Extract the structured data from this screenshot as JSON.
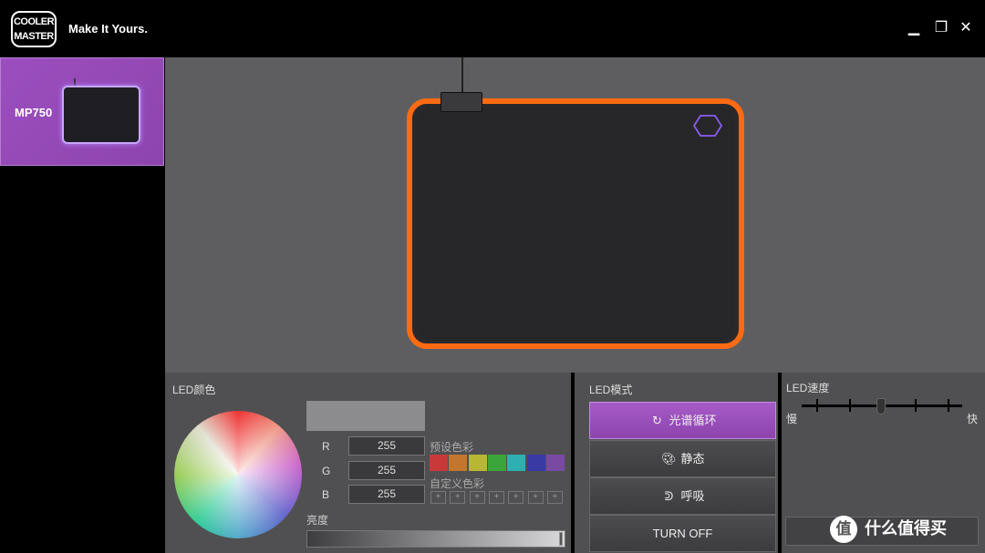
{
  "header": {
    "logo_text_1": "COOLER",
    "logo_text_2": "MASTER",
    "tagline": "Make It Yours.",
    "minimize": "▁",
    "maximize": "❐",
    "close": "✕"
  },
  "sidebar": {
    "devices": [
      {
        "name": "MP750"
      }
    ]
  },
  "color_panel": {
    "title": "LED颜色",
    "r_label": "R",
    "r_value": "255",
    "g_label": "G",
    "g_value": "255",
    "b_label": "B",
    "b_value": "255",
    "preset_label": "预设色彩",
    "presets": [
      "#c83a3a",
      "#c4762f",
      "#b7b734",
      "#3aa53a",
      "#2eb0b0",
      "#3a3aa5",
      "#7a4aa2"
    ],
    "custom_label": "自定义色彩",
    "custom_add": "+",
    "brightness_label": "亮度",
    "brightness_level": 1.0
  },
  "mode_panel": {
    "title": "LED模式",
    "modes": [
      {
        "label": "光谱循环",
        "icon": "refresh-icon",
        "active": true
      },
      {
        "label": "静态",
        "icon": "palette-icon",
        "active": false
      },
      {
        "label": "呼吸",
        "icon": "lungs-icon",
        "active": false
      },
      {
        "label": "TURN OFF",
        "icon": "",
        "active": false
      }
    ]
  },
  "speed_panel": {
    "title": "LED速度",
    "slow": "慢",
    "fast": "快",
    "speed_level": 3,
    "speed_steps": 5
  },
  "colors": {
    "accent": "#9b4fbf",
    "led_glow": "#ff6a13"
  },
  "watermark": {
    "badge": "值",
    "text": "什么值得买"
  }
}
